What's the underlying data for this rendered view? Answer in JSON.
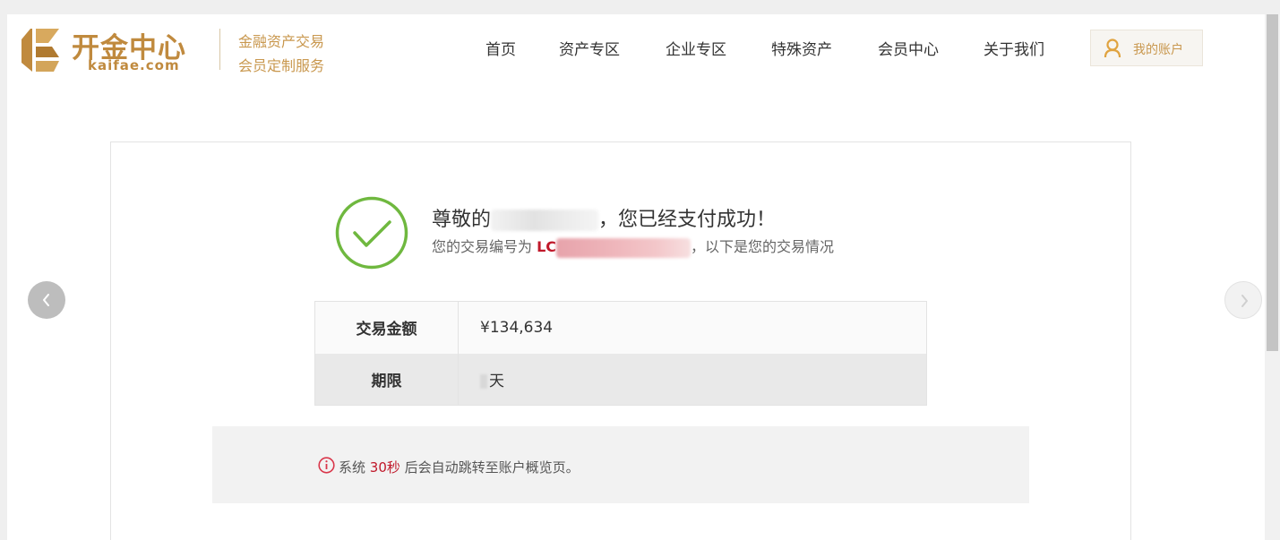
{
  "brand": {
    "name_cn": "开金中心",
    "domain": "kaifae.com",
    "slogan_line1": "金融资产交易",
    "slogan_line2": "会员定制服务",
    "color": "#c08a3e"
  },
  "nav": {
    "items": [
      "首页",
      "资产专区",
      "企业专区",
      "特殊资产",
      "会员中心",
      "关于我们"
    ],
    "account_label": "我的账户"
  },
  "result": {
    "greeting": "尊敬的",
    "success_text": "，您已经支付成功！",
    "tx_prefix_text": "您的交易编号为",
    "tx_no_visible": "LC",
    "tx_suffix_text": "，以下是您的交易情况",
    "accent_red": "#c0182a",
    "success_green": "#6fb83f"
  },
  "details": {
    "amount_label": "交易金额",
    "amount_value": "¥134,634",
    "term_label": "期限",
    "term_unit": "天"
  },
  "notice": {
    "prefix": "系统",
    "countdown": "30秒",
    "suffix": "后会自动跳转至账户概览页。"
  },
  "carousel": {
    "prev_icon": "chevron-left-icon",
    "next_icon": "chevron-right-icon"
  }
}
